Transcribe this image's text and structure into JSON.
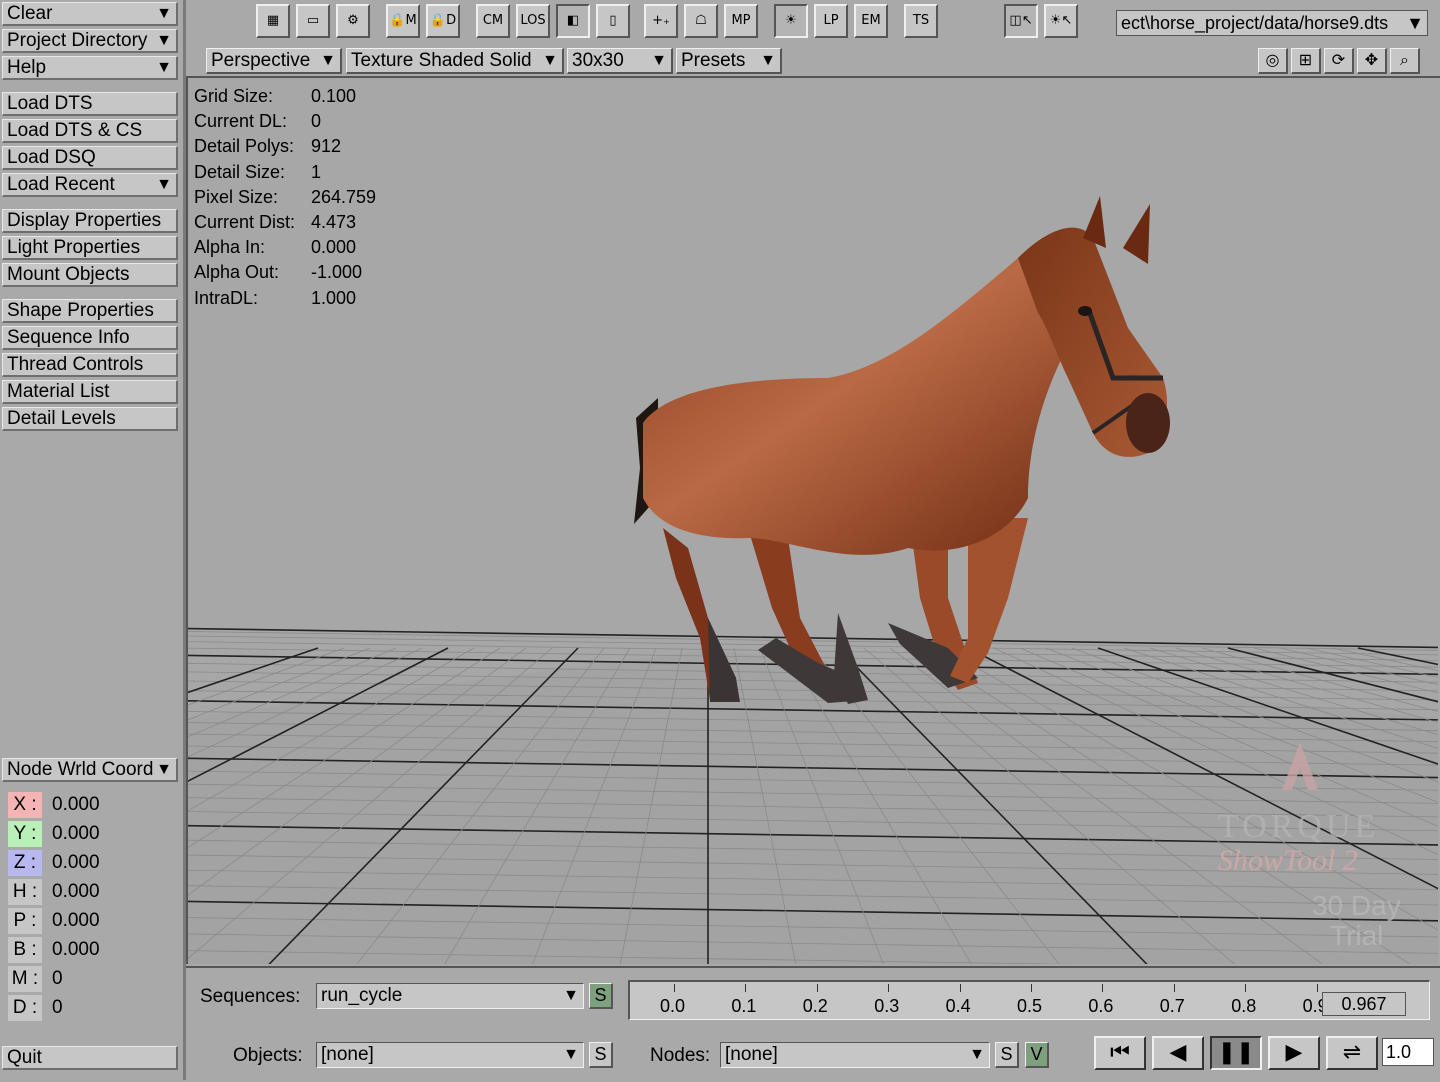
{
  "sidebar": {
    "top": [
      {
        "label": "Clear",
        "dropdown": true
      },
      {
        "label": "Project Directory",
        "dropdown": true
      },
      {
        "label": "Help",
        "dropdown": true
      }
    ],
    "load": [
      {
        "label": "Load DTS"
      },
      {
        "label": "Load DTS & CS"
      },
      {
        "label": "Load DSQ"
      },
      {
        "label": "Load Recent",
        "dropdown": true
      }
    ],
    "props": [
      "Display Properties",
      "Light Properties",
      "Mount Objects"
    ],
    "shape": [
      "Shape Properties",
      "Sequence Info",
      "Thread Controls",
      "Material List",
      "Detail Levels"
    ],
    "coord_mode": "Node Wrld Coord",
    "coords": [
      {
        "label": "X :",
        "value": "0.000",
        "color": "#f4b4b4"
      },
      {
        "label": "Y :",
        "value": "0.000",
        "color": "#b8f0b8"
      },
      {
        "label": "Z :",
        "value": "0.000",
        "color": "#b8b8f0"
      },
      {
        "label": "H :",
        "value": "0.000",
        "color": "#c6c6c6"
      },
      {
        "label": "P :",
        "value": "0.000",
        "color": "#c6c6c6"
      },
      {
        "label": "B :",
        "value": "0.000",
        "color": "#c6c6c6"
      },
      {
        "label": "M :",
        "value": "0",
        "color": "#c6c6c6"
      },
      {
        "label": "D :",
        "value": "0",
        "color": "#c6c6c6"
      }
    ],
    "quit": "Quit"
  },
  "toolbar": {
    "icons": [
      {
        "name": "grid-icon",
        "glyph": "▦",
        "on": false
      },
      {
        "name": "monitor-icon",
        "glyph": "▭",
        "on": false
      },
      {
        "name": "joint-icon",
        "glyph": "⚙",
        "on": false
      },
      {
        "name": "lock-m-icon",
        "glyph": "🔒M",
        "on": false
      },
      {
        "name": "lock-d-icon",
        "glyph": "🔒D",
        "on": false
      },
      {
        "name": "cm-icon",
        "glyph": "CM",
        "on": false
      },
      {
        "name": "los-icon",
        "glyph": "LOS",
        "on": false
      },
      {
        "name": "cube-icon",
        "glyph": "◧",
        "on": true
      },
      {
        "name": "book-icon",
        "glyph": "▯",
        "on": false
      },
      {
        "name": "add-point-icon",
        "glyph": "+₊",
        "on": false
      },
      {
        "name": "ghost-icon",
        "glyph": "☖",
        "on": false
      },
      {
        "name": "mp-icon",
        "glyph": "MP",
        "on": false
      },
      {
        "name": "light-icon",
        "glyph": "☀",
        "on": true
      },
      {
        "name": "lp-icon",
        "glyph": "LP",
        "on": false
      },
      {
        "name": "em-icon",
        "glyph": "EM",
        "on": false
      },
      {
        "name": "ts-icon",
        "glyph": "TS",
        "on": false
      },
      {
        "name": "camera-select-icon",
        "glyph": "◫↖",
        "on": true
      },
      {
        "name": "light-select-icon",
        "glyph": "☀↖",
        "on": false
      }
    ],
    "path": "ect\\horse_project/data/horse9.dts",
    "path_arrow": "▼"
  },
  "viewport_header": {
    "view_mode": "Perspective",
    "shading": "Texture Shaded Solid",
    "grid_res": "30x30",
    "presets": "Presets",
    "view_icons": [
      {
        "name": "target-icon",
        "glyph": "◎"
      },
      {
        "name": "fit-icon",
        "glyph": "⊞"
      },
      {
        "name": "rotate-icon",
        "glyph": "⟳"
      },
      {
        "name": "pan-icon",
        "glyph": "✥"
      },
      {
        "name": "zoom-icon",
        "glyph": "⌕"
      }
    ]
  },
  "stats": [
    {
      "label": "Grid Size:",
      "value": "0.100"
    },
    {
      "label": "Current DL:",
      "value": "0"
    },
    {
      "label": "Detail Polys:",
      "value": "912"
    },
    {
      "label": "Detail Size:",
      "value": "1"
    },
    {
      "label": "Pixel Size:",
      "value": "264.759"
    },
    {
      "label": "Current Dist:",
      "value": "4.473"
    },
    {
      "label": "Alpha In:",
      "value": "0.000"
    },
    {
      "label": "Alpha Out:",
      "value": "-1.000"
    },
    {
      "label": "IntraDL:",
      "value": "1.000"
    }
  ],
  "watermark": {
    "brand": "TORQUE",
    "product": "ShowTool 2",
    "line1": "30 Day",
    "line2": "Trial"
  },
  "bottom": {
    "sequences_label": "Sequences:",
    "sequence_value": "run_cycle",
    "seq_s": "S",
    "objects_label": "Objects:",
    "object_value": "[none]",
    "obj_s": "S",
    "nodes_label": "Nodes:",
    "node_value": "[none]",
    "node_s": "S",
    "node_v": "V",
    "timeline_ticks": [
      "0.0",
      "0.1",
      "0.2",
      "0.3",
      "0.4",
      "0.5",
      "0.6",
      "0.7",
      "0.8",
      "0.9"
    ],
    "current_time": "0.967",
    "speed": "1.0",
    "playback": [
      {
        "name": "first-frame-icon",
        "glyph": "⏮"
      },
      {
        "name": "step-back-icon",
        "glyph": "◀"
      },
      {
        "name": "pause-icon",
        "glyph": "❚❚",
        "on": true
      },
      {
        "name": "play-icon",
        "glyph": "▶"
      },
      {
        "name": "ping-pong-icon",
        "glyph": "⇌"
      }
    ]
  }
}
